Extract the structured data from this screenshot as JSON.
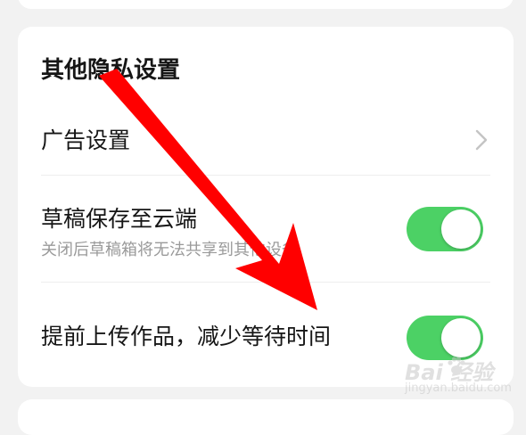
{
  "section": {
    "title": "其他隐私设置"
  },
  "settings": [
    {
      "label": "广告设置",
      "kind": "link"
    },
    {
      "label": "草稿保存至云端",
      "sublabel": "关闭后草稿箱将无法共享到其他设备",
      "kind": "toggle",
      "enabled": true
    },
    {
      "label": "提前上传作品，减少等待时间",
      "kind": "toggle",
      "enabled": true
    }
  ],
  "colors": {
    "toggle_on": "#4cd165",
    "arrow": "#ff0000",
    "background": "#f2f2f2",
    "card": "#ffffff"
  },
  "icons": {
    "link_indicator": "chevron-right-icon"
  },
  "watermark": {
    "logo": "Bai 经验",
    "url": "jingyan.baidu.com"
  }
}
